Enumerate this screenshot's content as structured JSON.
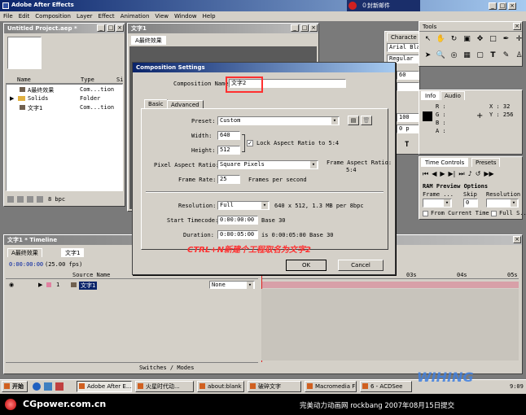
{
  "app": {
    "title": "Adobe After Effects",
    "menu": [
      "File",
      "Edit",
      "Composition",
      "Layer",
      "Effect",
      "Animation",
      "View",
      "Window",
      "Help"
    ],
    "chat_button": "０封新邮件"
  },
  "project": {
    "title": "Untitled Project.aep *",
    "columns": [
      "Name",
      "Type",
      "Si"
    ],
    "items": [
      {
        "name": "A最终效果",
        "type": "Com...tion"
      },
      {
        "name": "Solids",
        "type": "Folder"
      },
      {
        "name": "文字1",
        "type": "Com...tion"
      }
    ],
    "bpc": "8 bpc"
  },
  "comp_window": {
    "title": "文字1",
    "tab": "A最终效果",
    "tab2": "文字1"
  },
  "character": {
    "title": "Characte",
    "font": "Arial Blac",
    "style": "Regular",
    "fields": [
      "60",
      "",
      "100",
      "0 p"
    ],
    "t_label": "T"
  },
  "tools": {
    "title": "Tools"
  },
  "info": {
    "tab1": "Info",
    "tab2": "Audio",
    "r": "R :",
    "g": "G :",
    "b": "B :",
    "a": "A :",
    "x": "X : 32",
    "y": "Y : 256"
  },
  "time_controls": {
    "tab1": "Time Controls",
    "tab2": "Presets",
    "ram_title": "RAM Preview Options",
    "frame": "Frame ...",
    "skip": "Skip",
    "resolution": "Resolution",
    "skip_val": "0",
    "from_current": "From Current Time",
    "full_screen": "Full S..."
  },
  "dialog": {
    "title": "Composition Settings",
    "comp_name_label": "Composition Name:",
    "comp_name": "文字2",
    "tabs": [
      "Basic",
      "Advanced"
    ],
    "preset_label": "Preset:",
    "preset": "Custom",
    "width_label": "Width:",
    "width": "640",
    "height_label": "Height:",
    "height": "512",
    "lock_label": "Lock Aspect Ratio to 5:4",
    "par_label": "Pixel Aspect Ratio:",
    "par": "Square Pixels",
    "far_label": "Frame Aspect Ratio:",
    "far": "5:4",
    "fr_label": "Frame Rate:",
    "fr": "25",
    "fr_unit": "Frames per second",
    "res_label": "Resolution:",
    "res": "Full",
    "res_info": "640 x 512, 1.3 MB per 8bpc",
    "st_label": "Start Timecode:",
    "st": "0:00:00:00",
    "st_base": "Base 30",
    "dur_label": "Duration:",
    "dur": "0:00:05:00",
    "dur_info": "is 0:00:05:00  Base 30",
    "ok": "OK",
    "cancel": "Cancel"
  },
  "annotation": "CTRL+N新建个工程取名为文字2",
  "timeline": {
    "title": "文字1 * Timeline",
    "tabs": [
      "A最终效果",
      "文字1"
    ],
    "time": "0:00:00:00",
    "fps": "(25.00 fps)",
    "source_col": "Source Name",
    "layer_num": "1",
    "layer_name": "文字1",
    "mode": "None",
    "footer": "Switches / Modes",
    "ruler": [
      "03s",
      "04s",
      "05s"
    ]
  },
  "taskbar": {
    "start": "开始",
    "items": [
      "Adobe After E...",
      "火星时代动...",
      "about:blank - ...",
      "破碎文字",
      "Macromedia Fl...",
      "6 - ACDSee"
    ],
    "clock": "9:09"
  },
  "watermark": {
    "site": "CGpower.com.cn",
    "caption": "完美动力动画网 rockbang 2007年08月15日提交",
    "logo": "WIHING"
  },
  "colors": {
    "accent": "#0a246a",
    "annotation": "#ff3030",
    "red_bar": "#a02020",
    "track": "#d8a0a8"
  }
}
